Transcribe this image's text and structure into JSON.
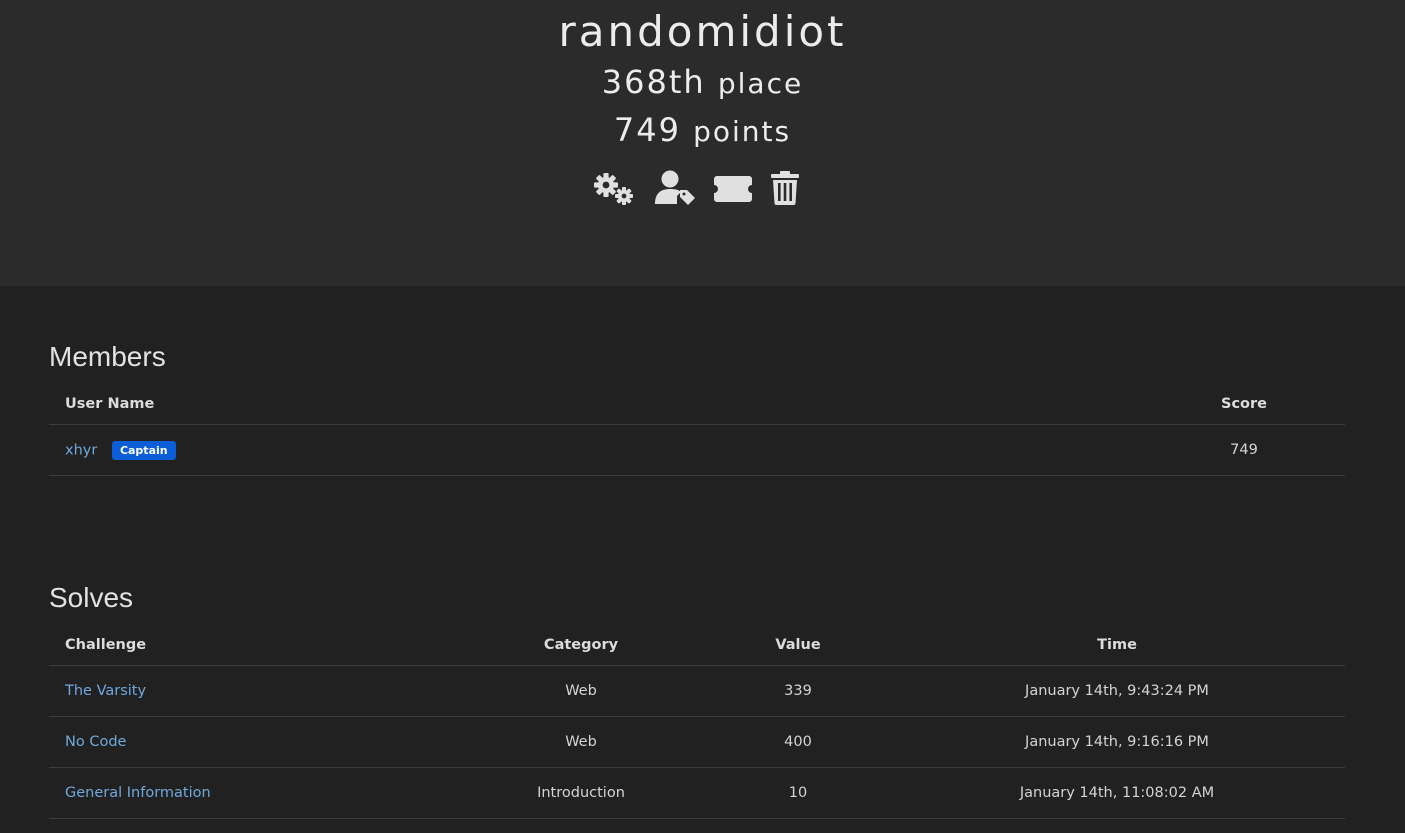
{
  "team": {
    "name": "randomidiot",
    "place_value": "368th",
    "place_label": "place",
    "points_value": "749",
    "points_label": "points"
  },
  "actions": [
    {
      "icon": "settings-icon"
    },
    {
      "icon": "user-tag-icon"
    },
    {
      "icon": "ticket-icon"
    },
    {
      "icon": "trash-icon"
    }
  ],
  "members": {
    "title": "Members",
    "headers": {
      "user_name": "User Name",
      "score": "Score"
    },
    "rows": [
      {
        "name": "xhyr",
        "badge": "Captain",
        "score": "749"
      }
    ]
  },
  "solves": {
    "title": "Solves",
    "headers": {
      "challenge": "Challenge",
      "category": "Category",
      "value": "Value",
      "time": "Time"
    },
    "rows": [
      {
        "challenge": "The Varsity",
        "category": "Web",
        "value": "339",
        "time": "January 14th, 9:43:24 PM"
      },
      {
        "challenge": "No Code",
        "category": "Web",
        "value": "400",
        "time": "January 14th, 9:16:16 PM"
      },
      {
        "challenge": "General Information",
        "category": "Introduction",
        "value": "10",
        "time": "January 14th, 11:08:02 AM"
      }
    ]
  },
  "colors": {
    "background": "#212121",
    "header_background": "#2b2b2b",
    "link": "#6fa8dc",
    "badge": "#0b5ed7"
  }
}
